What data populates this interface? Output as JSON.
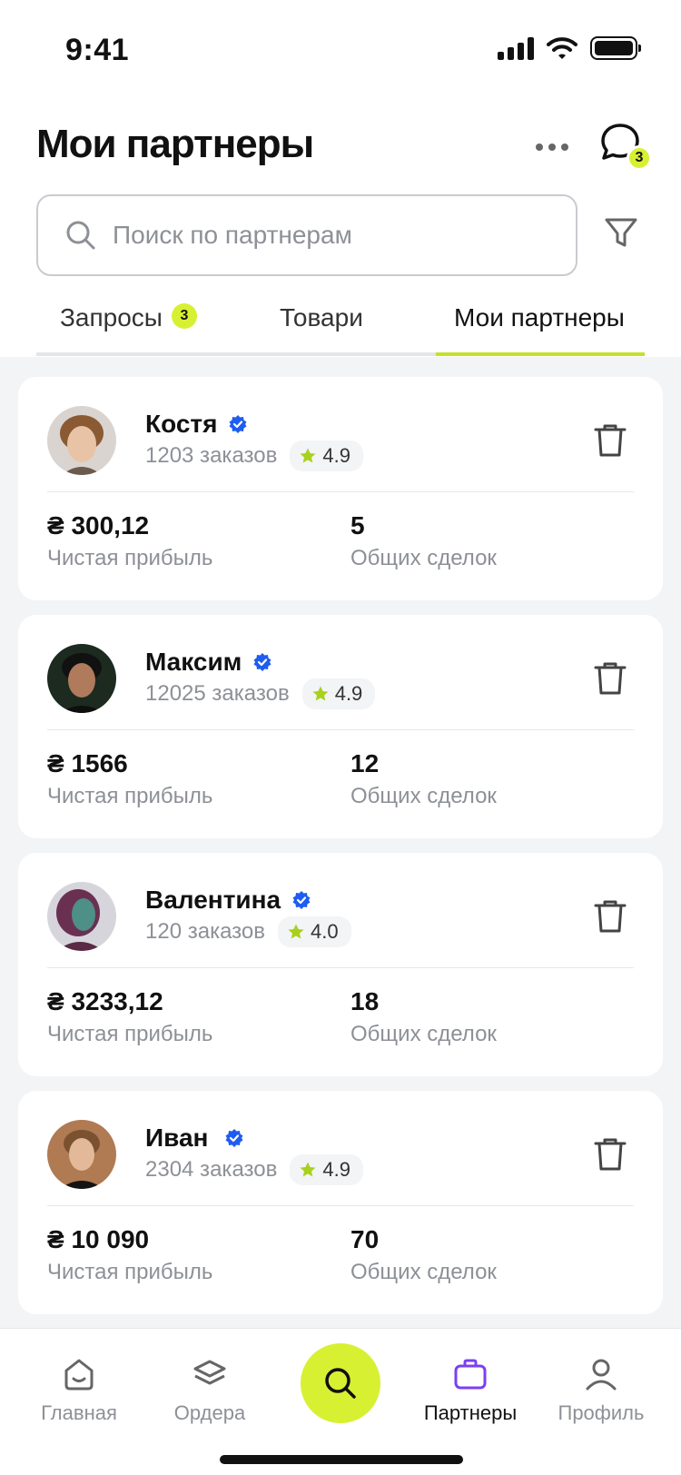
{
  "status_bar": {
    "time": "9:41"
  },
  "header": {
    "title": "Мои партнеры",
    "chat_badge": "3"
  },
  "search": {
    "placeholder": "Поиск по партнерам",
    "value": ""
  },
  "tabs": [
    {
      "label": "Запросы",
      "badge": "3"
    },
    {
      "label": "Товари"
    },
    {
      "label": "Мои партнеры",
      "active": true
    }
  ],
  "partners": [
    {
      "name": "Костя",
      "orders": "1203 заказов",
      "rating": "4.9",
      "profit": "₴ 300,12",
      "profit_label": "Чистая прибыль",
      "deals": "5",
      "deals_label": "Общих сделок"
    },
    {
      "name": "Максим",
      "orders": "12025 заказов",
      "rating": "4.9",
      "profit": "₴ 1566",
      "profit_label": "Чистая прибыль",
      "deals": "12",
      "deals_label": "Общих сделок"
    },
    {
      "name": "Валентина",
      "orders": "120 заказов",
      "rating": "4.0",
      "profit": "₴ 3233,12",
      "profit_label": "Чистая прибыль",
      "deals": "18",
      "deals_label": "Общих сделок"
    },
    {
      "name": "Иван",
      "orders": "2304 заказов",
      "rating": "4.9",
      "profit": "₴ 10 090",
      "profit_label": "Чистая прибыль",
      "deals": "70",
      "deals_label": "Общих сделок"
    }
  ],
  "bottom_nav": [
    {
      "label": "Главная",
      "icon": "home-icon"
    },
    {
      "label": "Ордера",
      "icon": "layers-icon"
    },
    {
      "label": "",
      "icon": "search-icon"
    },
    {
      "label": "Партнеры",
      "icon": "briefcase-icon",
      "active": true
    },
    {
      "label": "Профиль",
      "icon": "user-icon"
    }
  ],
  "colors": {
    "accent": "#d8f032",
    "active_nav": "#7b3ff2",
    "verified": "#1f5cf0",
    "star": "#a8d11e"
  }
}
